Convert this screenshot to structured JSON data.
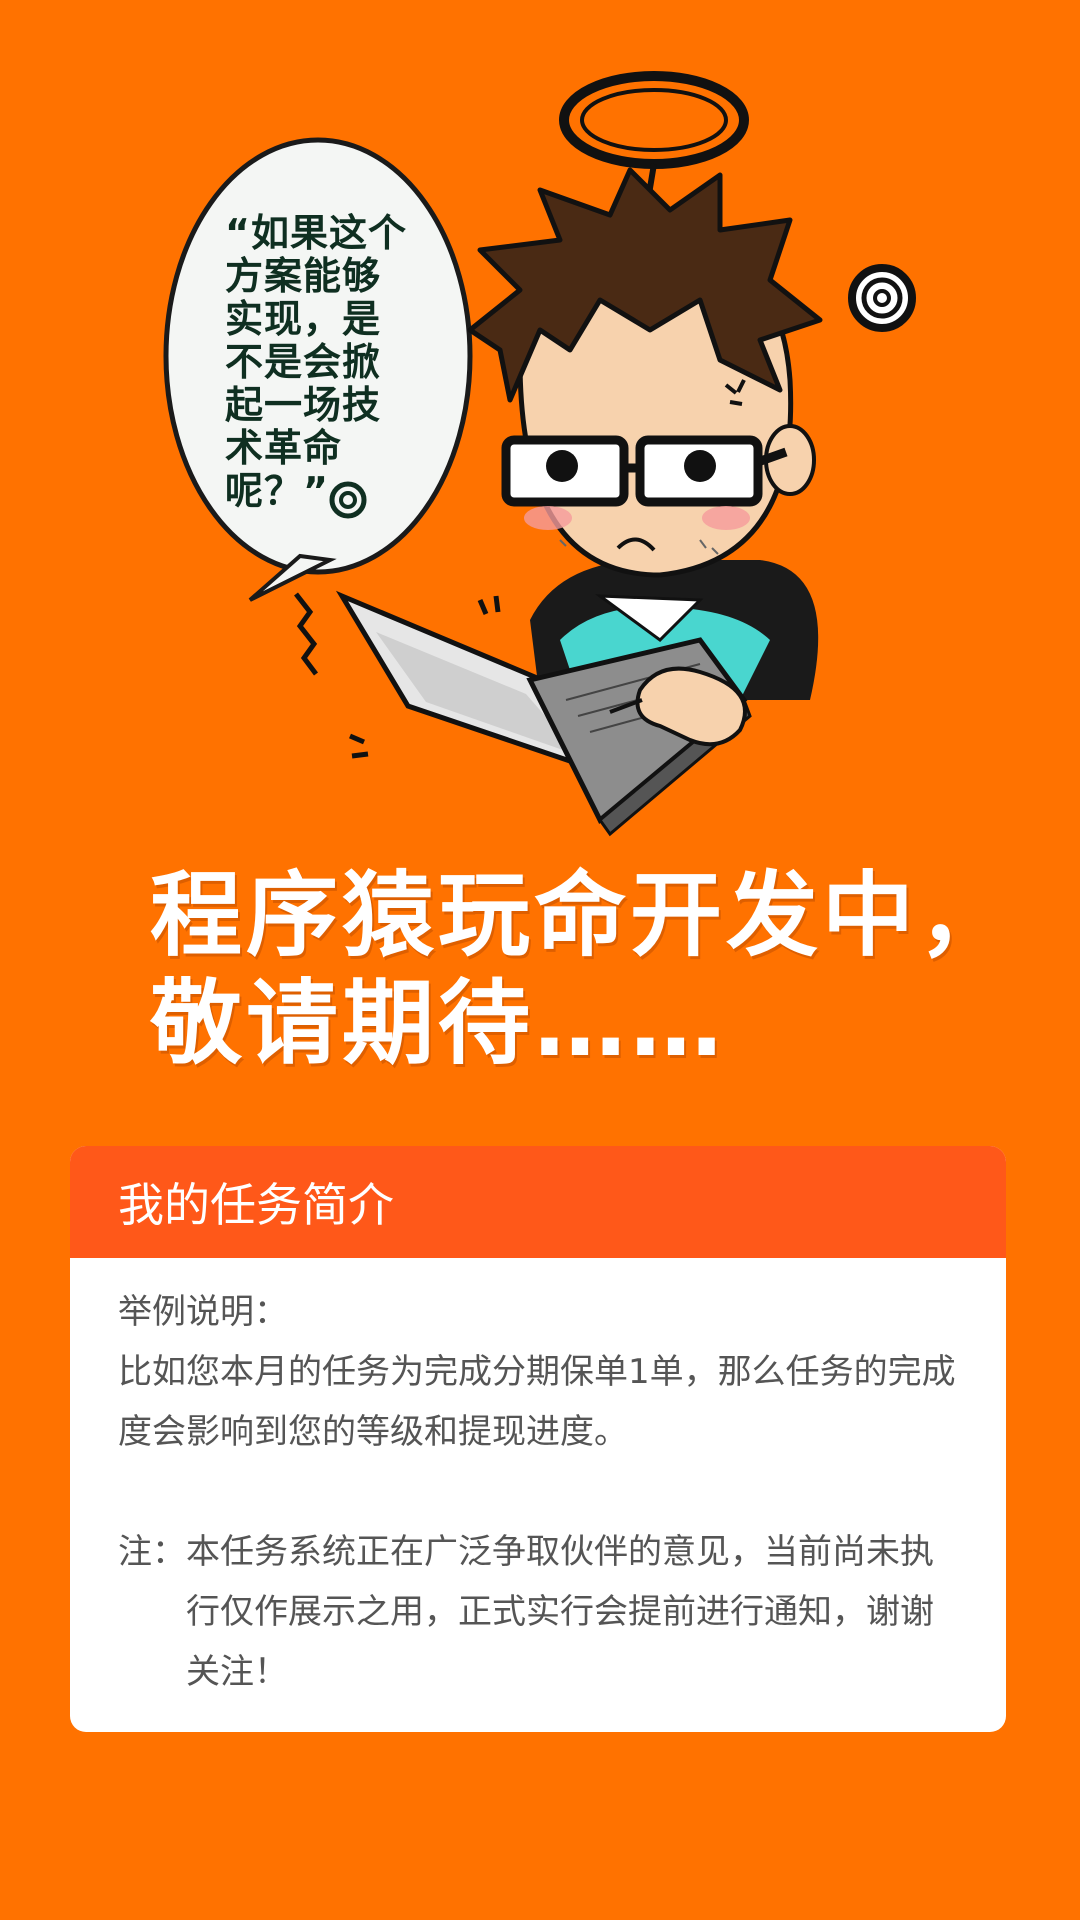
{
  "illustration": {
    "speech_bubble": "“如果这个方案能够实现，是不是会掀起一场技术革命呢？”",
    "icons": [
      "halo-icon",
      "spiral-icon",
      "laptop-icon",
      "programmer-character"
    ]
  },
  "headline": {
    "line1": "程序猿玩命开发中，",
    "line2": "敬请期待……"
  },
  "card": {
    "title": "我的任务简介",
    "example_heading": "举例说明：",
    "example_text": "比如您本月的任务为完成分期保单1单，那么任务的完成度会影响到您的等级和提现进度。",
    "note_label": "注：",
    "note_text": "本任务系统正在广泛争取伙伴的意见，当前尚未执行仅作展示之用，正式实行会提前进行通知，谢谢关注！"
  },
  "colors": {
    "background": "#ff7200",
    "card_header": "#ff5819",
    "card_body": "#ffffff",
    "body_text": "#555555"
  }
}
